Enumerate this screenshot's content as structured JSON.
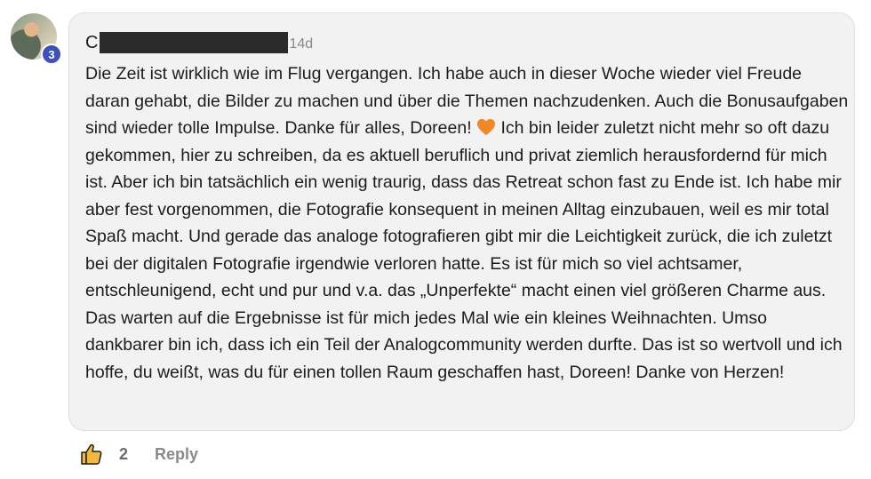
{
  "comment": {
    "author_initial": "C",
    "timestamp": "14d",
    "level_badge": "3",
    "text_parts": [
      "Die Zeit ist wirklich wie im Flug vergangen. Ich habe auch in dieser Woche wieder viel Freude daran gehabt, die Bilder zu machen und über die Themen nachzudenken. Auch die Bonusaufgaben sind wieder tolle Impulse. Danke für alles, Doreen! ",
      " Ich bin leider zuletzt nicht mehr so oft dazu gekommen, hier zu schreiben, da es aktuell beruflich und privat ziemlich herausfordernd für mich ist. Aber ich bin tatsächlich ein wenig traurig, dass das Retreat schon fast zu Ende ist. Ich habe mir aber fest vorgenommen, die Fotografie konsequent in meinen Alltag einzubauen, weil es mir total Spaß macht. Und gerade das analoge fotografieren gibt mir die Leichtigkeit zurück, die ich zuletzt bei der digitalen Fotografie irgendwie verloren hatte. Es ist für mich so viel achtsamer, entschleunigend, echt und pur und v.a. das „Unperfekte“ macht einen viel größeren Charme aus. Das warten auf die Ergebnisse ist für mich jedes Mal wie ein kleines Weihnachten. Umso dankbarer bin ich, dass ich ein Teil der Analogcommunity werden durfte. Das ist so wertvoll und ich hoffe, du weißt, was du für einen tollen Raum geschaffen hast, Doreen! Danke von Herzen!"
    ],
    "emoji_icon": "orange-heart-icon",
    "likes": "2",
    "reply_label": "Reply"
  },
  "colors": {
    "bubble": "#f2f2f2",
    "badge": "#3f51b5",
    "heart": "#f0882a"
  }
}
